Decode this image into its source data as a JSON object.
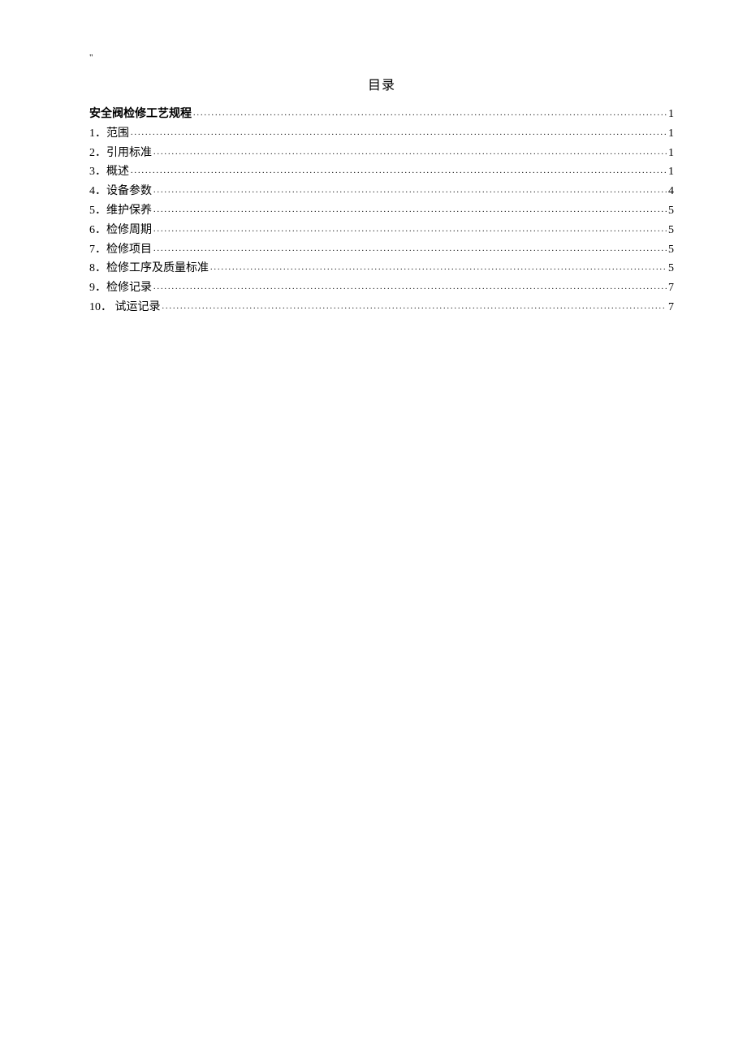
{
  "header_mark": "\"",
  "toc_title": "目录",
  "toc": [
    {
      "label": "安全阀检修工艺规程",
      "page": "1",
      "bold": true,
      "indent": 0
    },
    {
      "label": "1．范围",
      "page": "1",
      "bold": false,
      "indent": 1
    },
    {
      "label": "2．引用标准",
      "page": "1",
      "bold": false,
      "indent": 1
    },
    {
      "label": "3．概述",
      "page": "1",
      "bold": false,
      "indent": 1
    },
    {
      "label": "4．设备参数",
      "page": "4",
      "bold": false,
      "indent": 1
    },
    {
      "label": "5．维护保养",
      "page": "5",
      "bold": false,
      "indent": 1
    },
    {
      "label": "6．检修周期",
      "page": "5",
      "bold": false,
      "indent": 1
    },
    {
      "label": "7．检修项目",
      "page": "5",
      "bold": false,
      "indent": 1
    },
    {
      "label": "8．检修工序及质量标准",
      "page": "5",
      "bold": false,
      "indent": 1
    },
    {
      "label": "9．检修记录",
      "page": "7",
      "bold": false,
      "indent": 1
    },
    {
      "label": "10． 试运记录",
      "page": "7",
      "bold": false,
      "indent": 1
    }
  ]
}
